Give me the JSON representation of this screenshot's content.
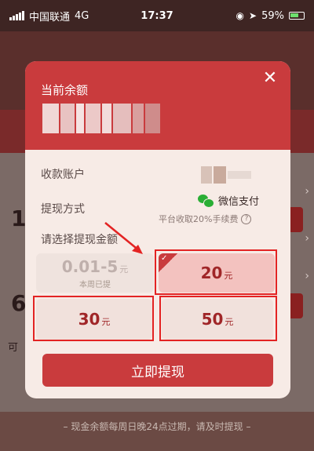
{
  "status_bar": {
    "carrier": "中国联通",
    "network": "4G",
    "time": "17:37",
    "battery": "59%"
  },
  "modal": {
    "title": "当前余额",
    "close_icon": "close-icon",
    "account_label": "收款账户",
    "method_label": "提现方式",
    "method_value": "微信支付",
    "fee_note": "平台收取20%手续费",
    "help_icon": "?",
    "choose_label": "请选择提现金额",
    "options": [
      {
        "value": "0.01-5",
        "unit": "元",
        "sub": "本周已提",
        "state": "disabled"
      },
      {
        "value": "20",
        "unit": "元",
        "state": "selected"
      },
      {
        "value": "30",
        "unit": "元",
        "state": "normal"
      },
      {
        "value": "50",
        "unit": "元",
        "state": "normal"
      }
    ],
    "cta": "立即提现"
  },
  "background": {
    "digit1": "1",
    "digit2": "6",
    "small_text": "可",
    "bottom_note": "– 现金余额每周日晚24点过期，请及时提现 –"
  },
  "colors": {
    "brand_red": "#c93b3d",
    "wechat_green": "#2aae35",
    "annotation_red": "#e32323"
  }
}
